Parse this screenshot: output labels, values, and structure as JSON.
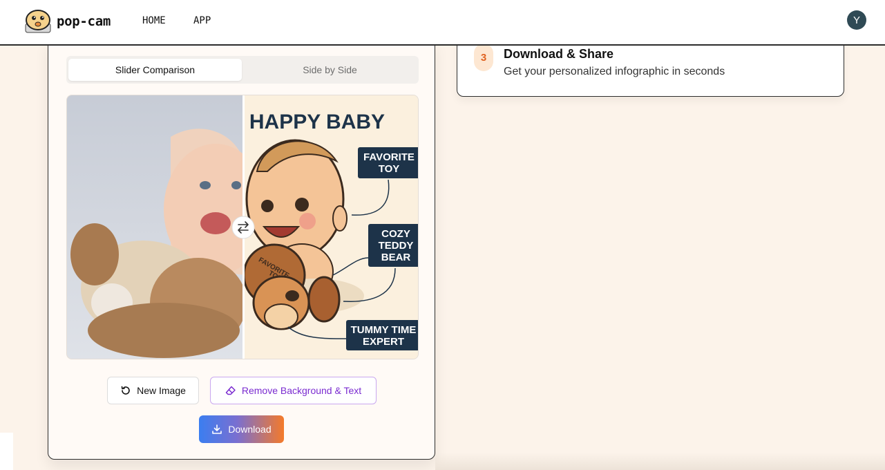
{
  "header": {
    "brand": "pop-cam",
    "nav": [
      {
        "label": "HOME"
      },
      {
        "label": "APP"
      }
    ],
    "avatar_initial": "Y"
  },
  "comparison": {
    "tabs": [
      {
        "label": "Slider Comparison",
        "active": true
      },
      {
        "label": "Side by Side",
        "active": false
      }
    ],
    "infographic": {
      "title": "A HAPPY BABY",
      "labels": [
        {
          "lines": [
            "FAVORITE",
            "TOY"
          ]
        },
        {
          "lines": [
            "COZY",
            "TEDDY",
            "BEAR"
          ]
        },
        {
          "lines": [
            "TUMMY TIME",
            "EXPERT"
          ]
        }
      ],
      "badge_lines": [
        "FAVORITE",
        "TOY"
      ]
    },
    "slider_position": 0.5
  },
  "actions": {
    "new_image": "New Image",
    "remove_bg": "Remove Background & Text",
    "download": "Download"
  },
  "step": {
    "number": "3",
    "title": "Download & Share",
    "description": "Get your personalized infographic in seconds"
  },
  "colors": {
    "accent_purple": "#7a2bd0",
    "accent_orange": "#e0611f",
    "label_navy": "#1d3349",
    "background": "#fcf3ea"
  },
  "icons": [
    "pop-cam-logo-icon",
    "refresh-icon",
    "eraser-icon",
    "download-icon",
    "swap-arrows-icon"
  ]
}
